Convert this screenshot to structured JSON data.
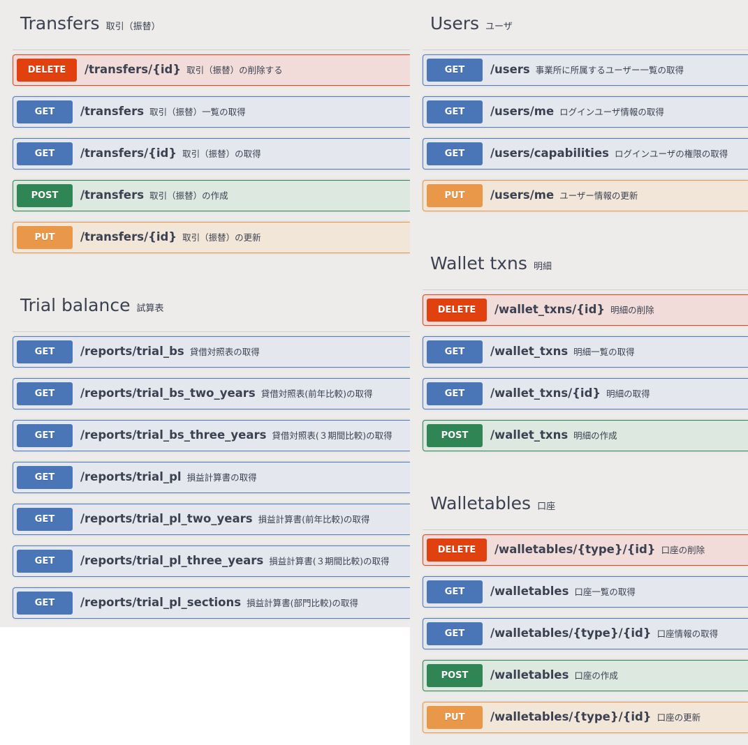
{
  "left": {
    "transfers": {
      "name": "Transfers",
      "desc": "取引（振替）",
      "ops": [
        {
          "method": "DELETE",
          "path": "/transfers/{id}",
          "summary": "取引（振替）の削除する"
        },
        {
          "method": "GET",
          "path": "/transfers",
          "summary": "取引（振替）一覧の取得"
        },
        {
          "method": "GET",
          "path": "/transfers/{id}",
          "summary": "取引（振替）の取得"
        },
        {
          "method": "POST",
          "path": "/transfers",
          "summary": "取引（振替）の作成"
        },
        {
          "method": "PUT",
          "path": "/transfers/{id}",
          "summary": "取引（振替）の更新"
        }
      ]
    },
    "trial_balance": {
      "name": "Trial balance",
      "desc": "試算表",
      "ops": [
        {
          "method": "GET",
          "path": "/reports/trial_bs",
          "summary": "貸借対照表の取得"
        },
        {
          "method": "GET",
          "path": "/reports/trial_bs_two_years",
          "summary": "貸借対照表(前年比較)の取得"
        },
        {
          "method": "GET",
          "path": "/reports/trial_bs_three_years",
          "summary": "貸借対照表(３期間比較)の取得"
        },
        {
          "method": "GET",
          "path": "/reports/trial_pl",
          "summary": "損益計算書の取得"
        },
        {
          "method": "GET",
          "path": "/reports/trial_pl_two_years",
          "summary": "損益計算書(前年比較)の取得"
        },
        {
          "method": "GET",
          "path": "/reports/trial_pl_three_years",
          "summary": "損益計算書(３期間比較)の取得"
        },
        {
          "method": "GET",
          "path": "/reports/trial_pl_sections",
          "summary": "損益計算書(部門比較)の取得"
        }
      ]
    }
  },
  "right": {
    "users": {
      "name": "Users",
      "desc": "ユーザ",
      "ops": [
        {
          "method": "GET",
          "path": "/users",
          "summary": "事業所に所属するユーザー一覧の取得"
        },
        {
          "method": "GET",
          "path": "/users/me",
          "summary": "ログインユーザ情報の取得"
        },
        {
          "method": "GET",
          "path": "/users/capabilities",
          "summary": "ログインユーザの権限の取得"
        },
        {
          "method": "PUT",
          "path": "/users/me",
          "summary": "ユーザー情報の更新"
        }
      ]
    },
    "wallet_txns": {
      "name": "Wallet txns",
      "desc": "明細",
      "ops": [
        {
          "method": "DELETE",
          "path": "/wallet_txns/{id}",
          "summary": "明細の削除"
        },
        {
          "method": "GET",
          "path": "/wallet_txns",
          "summary": "明細一覧の取得"
        },
        {
          "method": "GET",
          "path": "/wallet_txns/{id}",
          "summary": "明細の取得"
        },
        {
          "method": "POST",
          "path": "/wallet_txns",
          "summary": "明細の作成"
        }
      ]
    },
    "walletables": {
      "name": "Walletables",
      "desc": "口座",
      "ops": [
        {
          "method": "DELETE",
          "path": "/walletables/{type}/{id}",
          "summary": "口座の削除"
        },
        {
          "method": "GET",
          "path": "/walletables",
          "summary": "口座一覧の取得"
        },
        {
          "method": "GET",
          "path": "/walletables/{type}/{id}",
          "summary": "口座情報の取得"
        },
        {
          "method": "POST",
          "path": "/walletables",
          "summary": "口座の作成"
        },
        {
          "method": "PUT",
          "path": "/walletables/{type}/{id}",
          "summary": "口座の更新"
        }
      ]
    }
  },
  "colors": {
    "get": "#4a76b8",
    "delete": "#e1400f",
    "post": "#2f8553",
    "put": "#e99748",
    "panel_bg": "#edecea",
    "text": "#3b4151"
  }
}
